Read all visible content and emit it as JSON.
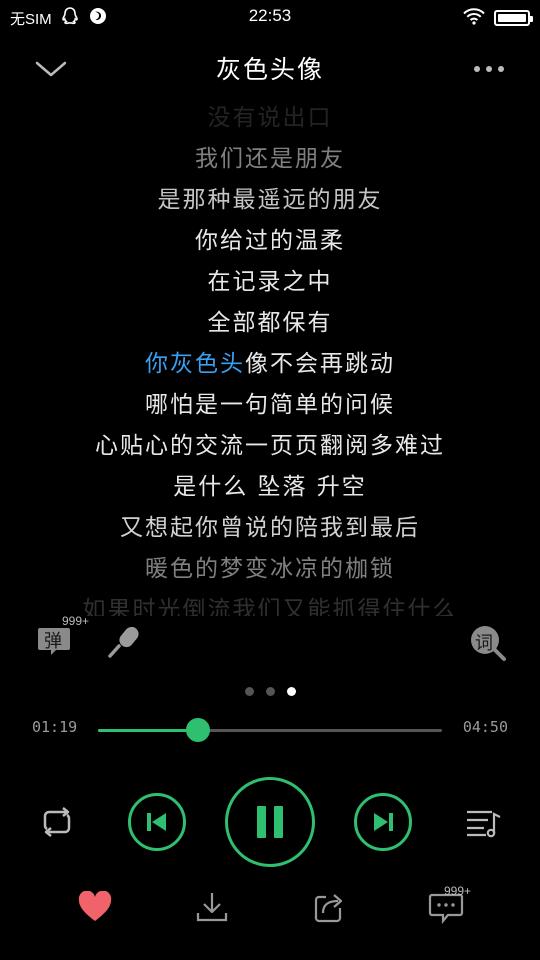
{
  "status_bar": {
    "carrier": "无SIM",
    "time": "22:53",
    "battery_level": 1.0
  },
  "header": {
    "title": "灰色头像"
  },
  "lyrics": [
    {
      "text": "没有说出口",
      "opacity": 0.15
    },
    {
      "text": "我们还是朋友",
      "opacity": 0.55
    },
    {
      "text": "是那种最遥远的朋友",
      "opacity": 0.85
    },
    {
      "text": "你给过的温柔",
      "opacity": 1
    },
    {
      "text": "在记录之中",
      "opacity": 1
    },
    {
      "text": "全部都保有",
      "opacity": 1
    },
    {
      "text": "你灰色头像不会再跳动",
      "opacity": 1,
      "highlight": "你灰色头",
      "rest": "像不会再跳动"
    },
    {
      "text": "哪怕是一句简单的问候",
      "opacity": 1
    },
    {
      "text": "心贴心的交流一页页翻阅多难过",
      "opacity": 1
    },
    {
      "text": "是什么 坠落 升空",
      "opacity": 1
    },
    {
      "text": "又想起你曾说的陪我到最后",
      "opacity": 0.9
    },
    {
      "text": "暖色的梦变冰凉的枷锁",
      "opacity": 0.55
    },
    {
      "text": "如果时光倒流我们又能抓得住什么",
      "opacity": 0.2
    }
  ],
  "functions": {
    "danmu_label": "弹",
    "danmu_badge": "999+",
    "lyric_label": "词"
  },
  "pager": {
    "count": 3,
    "active": 2
  },
  "player": {
    "current_time": "01:19",
    "total_time": "04:50",
    "progress": 0.29,
    "state": "playing"
  },
  "bottom": {
    "comment_badge": "999+"
  },
  "colors": {
    "accent": "#2fbf71",
    "highlight_lyric": "#3aa0f0",
    "heart": "#f0636b"
  },
  "icons": [
    "chevron-down-icon",
    "more-icon",
    "danmu-icon",
    "microphone-icon",
    "lyric-icon",
    "repeat-icon",
    "previous-icon",
    "pause-icon",
    "next-icon",
    "playlist-icon",
    "heart-icon",
    "download-icon",
    "share-icon",
    "comment-icon"
  ]
}
